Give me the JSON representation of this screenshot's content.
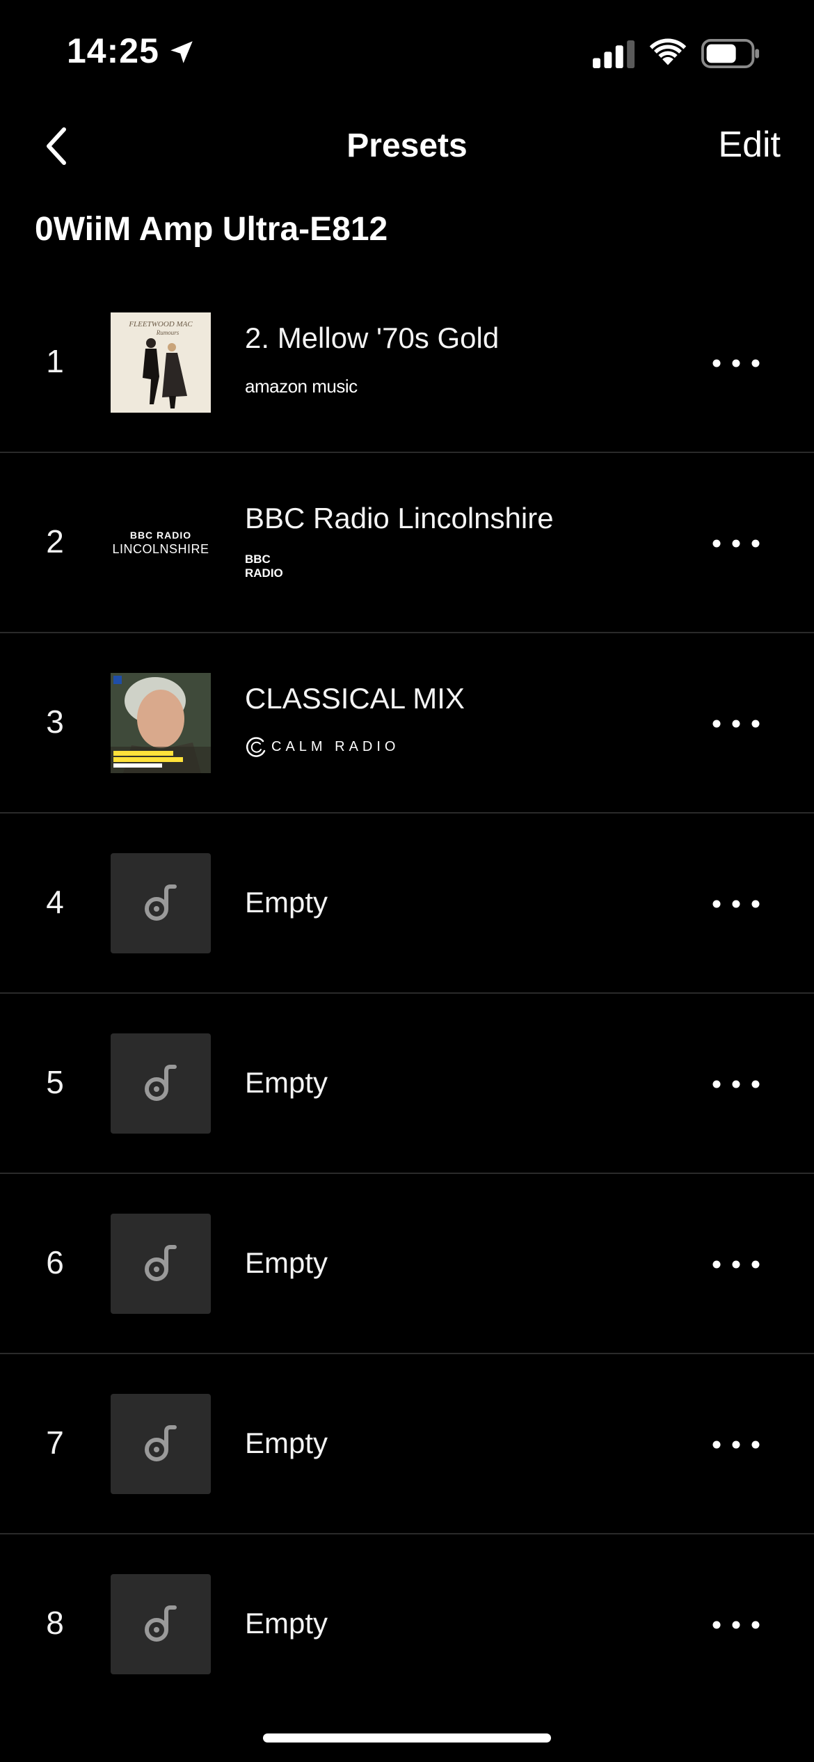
{
  "status_bar": {
    "time": "14:25",
    "icons": [
      "location-arrow-icon",
      "cellular-signal-icon",
      "wifi-icon",
      "battery-icon"
    ]
  },
  "nav": {
    "back_icon": "chevron-left-icon",
    "title": "Presets",
    "edit_label": "Edit"
  },
  "device_name": "0WiiM Amp Ultra-E812",
  "presets": [
    {
      "number": "1",
      "title": "2. Mellow '70s Gold",
      "source_name": "amazon music",
      "art": "fleetwood-mac-rumours-cover"
    },
    {
      "number": "2",
      "title": "BBC Radio Lincolnshire",
      "source_name": "BBC RADIO",
      "art": "bbc-radio-lincolnshire-logo",
      "art_text_top": "BBC RADIO",
      "art_text_bottom": "LINCOLNSHIRE"
    },
    {
      "number": "3",
      "title": "CLASSICAL MIX",
      "source_name": "CALM RADIO",
      "art": "haydn-complete-symphonies-cover"
    },
    {
      "number": "4",
      "title": "Empty",
      "art": "music-note-icon"
    },
    {
      "number": "5",
      "title": "Empty",
      "art": "music-note-icon"
    },
    {
      "number": "6",
      "title": "Empty",
      "art": "music-note-icon"
    },
    {
      "number": "7",
      "title": "Empty",
      "art": "music-note-icon"
    },
    {
      "number": "8",
      "title": "Empty",
      "art": "music-note-icon"
    }
  ],
  "more_icon": "more-dots-icon",
  "colors": {
    "background": "#000000",
    "divider": "#2a2a2a",
    "empty_tile": "#2b2b2b",
    "note_icon": "#9a9a9a"
  }
}
